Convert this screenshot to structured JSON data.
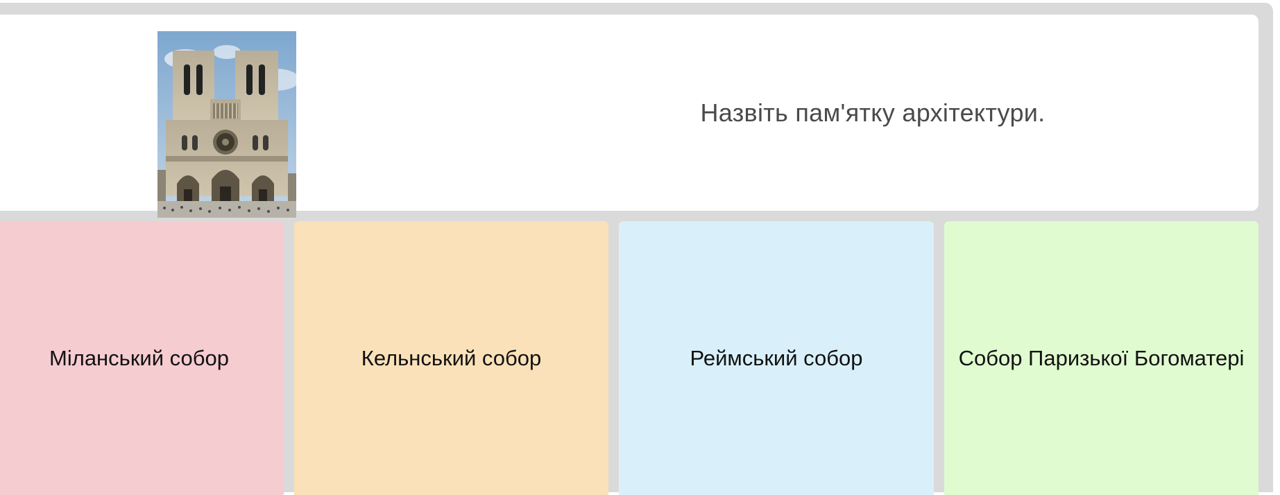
{
  "question": {
    "text": "Назвіть пам'ятку архітектури.",
    "image": "notre-dame-cathedral-photo"
  },
  "answers": [
    {
      "label": "Міланський собор",
      "color": "#f5ccd0"
    },
    {
      "label": "Кельнський собор",
      "color": "#fae1b9"
    },
    {
      "label": "Реймський собор",
      "color": "#d9f0fa"
    },
    {
      "label": "Собор Паризької Богоматері",
      "color": "#e0fbd0"
    }
  ],
  "colors": {
    "frame": "#dadada",
    "card": "#ffffff",
    "question_text": "#4a4a4a"
  }
}
